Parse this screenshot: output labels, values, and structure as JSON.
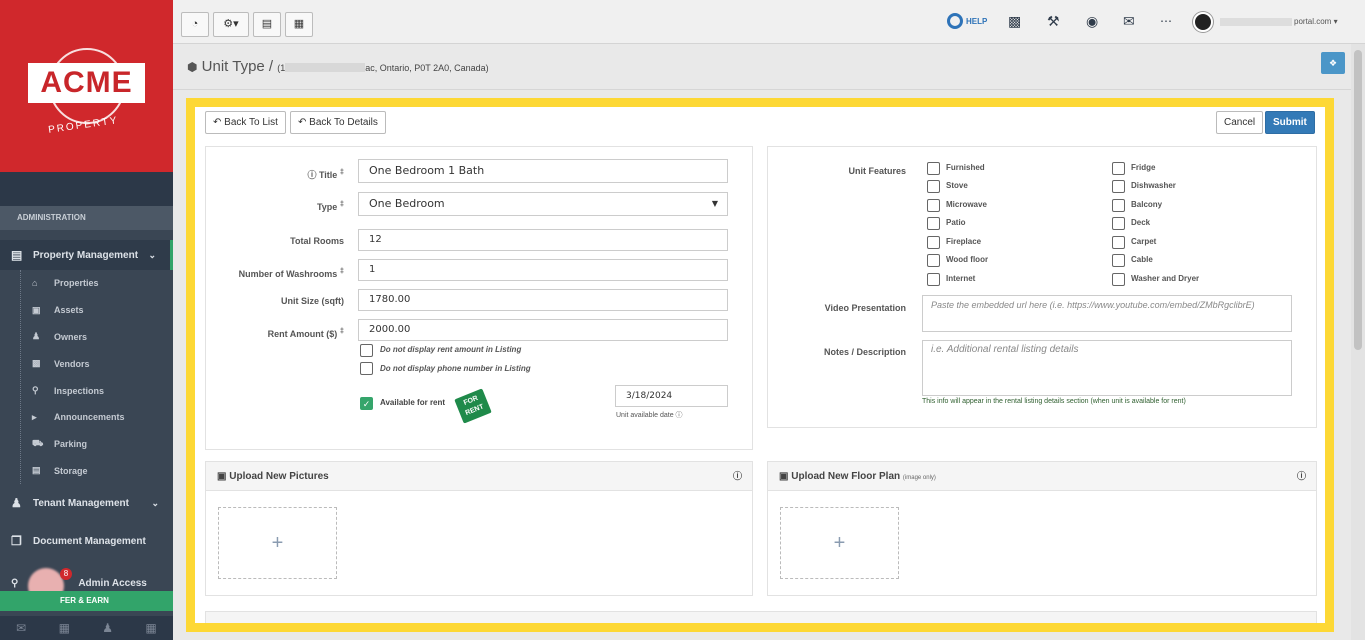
{
  "sidebar": {
    "logo": "ACME",
    "logo_sub": "PROPERTY",
    "section_label": "ADMINISTRATION",
    "property_management": "Property Management",
    "items": [
      {
        "label": "Properties",
        "icon": "home-icon"
      },
      {
        "label": "Assets",
        "icon": "asset-icon"
      },
      {
        "label": "Owners",
        "icon": "owner-icon"
      },
      {
        "label": "Vendors",
        "icon": "vendor-icon"
      },
      {
        "label": "Inspections",
        "icon": "search-icon"
      },
      {
        "label": "Announcements",
        "icon": "megaphone-icon"
      },
      {
        "label": "Parking",
        "icon": "car-icon"
      },
      {
        "label": "Storage",
        "icon": "storage-icon"
      }
    ],
    "tenant_management": "Tenant Management",
    "document_management": "Document Management",
    "admin_access": "Admin Access",
    "refer": "FER & EARN",
    "badge_count": "8"
  },
  "topbar": {
    "help": "HELP",
    "email_suffix": "portal.com"
  },
  "page": {
    "title": "Unit Type /",
    "address_prefix": "(1",
    "address_suffix": "ac, Ontario, P0T 2A0, Canada)"
  },
  "actions": {
    "back_to_list": "Back To List",
    "back_to_details": "Back To Details",
    "cancel": "Cancel",
    "submit": "Submit"
  },
  "form": {
    "title_label": "Title",
    "title_value": "One Bedroom 1 Bath",
    "type_label": "Type",
    "type_value": "One Bedroom",
    "total_rooms_label": "Total Rooms",
    "total_rooms_value": "12",
    "washrooms_label": "Number of Washrooms",
    "washrooms_value": "1",
    "unit_size_label": "Unit Size (sqft)",
    "unit_size_value": "1780.00",
    "rent_label": "Rent Amount ($)",
    "rent_value": "2000.00",
    "no_rent_display": "Do not display rent amount in Listing",
    "no_phone_display": "Do not display phone number in Listing",
    "available_label": "Available for rent",
    "for_rent_sign": "FOR RENT",
    "available_date": "3/18/2024",
    "available_date_hint": "Unit available date"
  },
  "features": {
    "label": "Unit Features",
    "left": [
      "Furnished",
      "Stove",
      "Microwave",
      "Patio",
      "Fireplace",
      "Wood floor",
      "Internet"
    ],
    "right": [
      "Fridge",
      "Dishwasher",
      "Balcony",
      "Deck",
      "Carpet",
      "Cable",
      "Washer and Dryer"
    ],
    "video_label": "Video Presentation",
    "video_placeholder": "Paste the embedded url here (i.e. https://www.youtube.com/embed/ZMbRgclibrE)",
    "notes_label": "Notes / Description",
    "notes_placeholder": "i.e. Additional rental listing details",
    "notes_hint": "This info will appear in the rental listing details section (when unit is available for rent)"
  },
  "uploads": {
    "pictures": "Upload New Pictures",
    "floor_plan": "Upload New Floor Plan",
    "floor_plan_note": "(image only)",
    "plus": "+"
  }
}
